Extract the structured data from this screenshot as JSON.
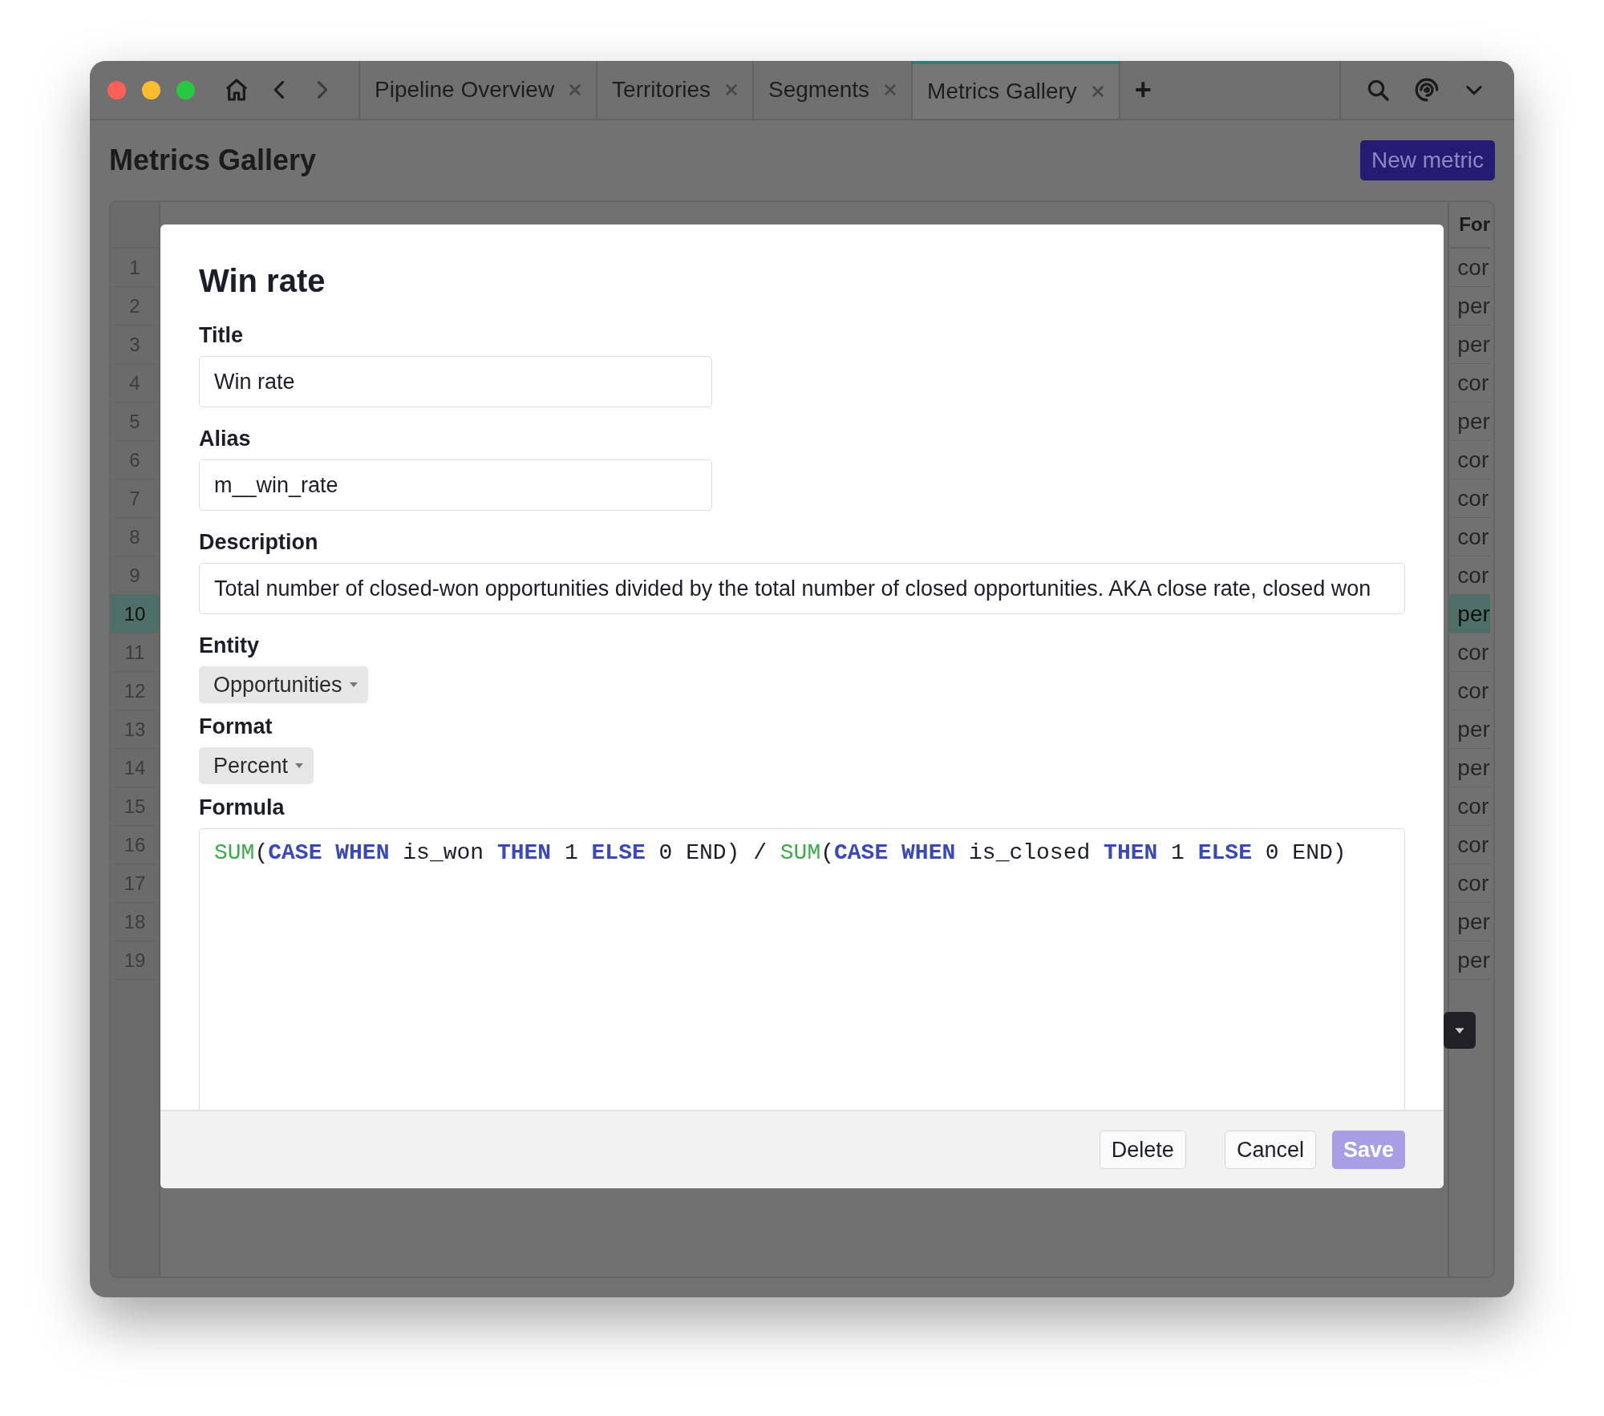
{
  "tabs": [
    {
      "label": "Pipeline Overview",
      "selected": false
    },
    {
      "label": "Territories",
      "selected": false
    },
    {
      "label": "Segments",
      "selected": false
    },
    {
      "label": "Metrics Gallery",
      "selected": true
    }
  ],
  "new_tab": "+",
  "page_title": "Metrics Gallery",
  "new_metric_button": "New metric",
  "table": {
    "column_header": "For",
    "rows": [
      {
        "number": "1",
        "value": "cor",
        "selected": false
      },
      {
        "number": "2",
        "value": "per",
        "selected": false
      },
      {
        "number": "3",
        "value": "per",
        "selected": false
      },
      {
        "number": "4",
        "value": "cor",
        "selected": false
      },
      {
        "number": "5",
        "value": "per",
        "selected": false
      },
      {
        "number": "6",
        "value": "cor",
        "selected": false
      },
      {
        "number": "7",
        "value": "cor",
        "selected": false
      },
      {
        "number": "8",
        "value": "cor",
        "selected": false
      },
      {
        "number": "9",
        "value": "cor",
        "selected": false
      },
      {
        "number": "10",
        "value": "per",
        "selected": true
      },
      {
        "number": "11",
        "value": "cor",
        "selected": false
      },
      {
        "number": "12",
        "value": "cor",
        "selected": false
      },
      {
        "number": "13",
        "value": "per",
        "selected": false
      },
      {
        "number": "14",
        "value": "per",
        "selected": false
      },
      {
        "number": "15",
        "value": "cor",
        "selected": false
      },
      {
        "number": "16",
        "value": "cor",
        "selected": false
      },
      {
        "number": "17",
        "value": "cor",
        "selected": false
      },
      {
        "number": "18",
        "value": "per",
        "selected": false
      },
      {
        "number": "19",
        "value": "per",
        "selected": false
      }
    ]
  },
  "modal": {
    "title": "Win rate",
    "title_label": "Title",
    "title_value": "Win rate",
    "alias_label": "Alias",
    "alias_value": "m__win_rate",
    "description_label": "Description",
    "description_value": "Total number of closed-won opportunities divided by the total number of closed opportunities. AKA close rate, closed won",
    "entity_label": "Entity",
    "entity_value": "Opportunities",
    "format_label": "Format",
    "format_value": "Percent",
    "formula_label": "Formula",
    "formula": [
      {
        "kind": "func",
        "text": "SUM"
      },
      {
        "kind": "plain",
        "text": "("
      },
      {
        "kind": "keyword",
        "text": "CASE WHEN"
      },
      {
        "kind": "plain",
        "text": " is_won "
      },
      {
        "kind": "keyword",
        "text": "THEN"
      },
      {
        "kind": "plain",
        "text": " 1 "
      },
      {
        "kind": "keyword",
        "text": "ELSE"
      },
      {
        "kind": "plain",
        "text": " 0 END) / "
      },
      {
        "kind": "func",
        "text": "SUM"
      },
      {
        "kind": "plain",
        "text": "("
      },
      {
        "kind": "keyword",
        "text": "CASE WHEN"
      },
      {
        "kind": "plain",
        "text": " is_closed "
      },
      {
        "kind": "keyword",
        "text": "THEN"
      },
      {
        "kind": "plain",
        "text": " 1 "
      },
      {
        "kind": "keyword",
        "text": "ELSE"
      },
      {
        "kind": "plain",
        "text": " 0 END)"
      }
    ],
    "buttons": {
      "delete": "Delete",
      "cancel": "Cancel",
      "save": "Save",
      "save_disabled": true
    }
  }
}
